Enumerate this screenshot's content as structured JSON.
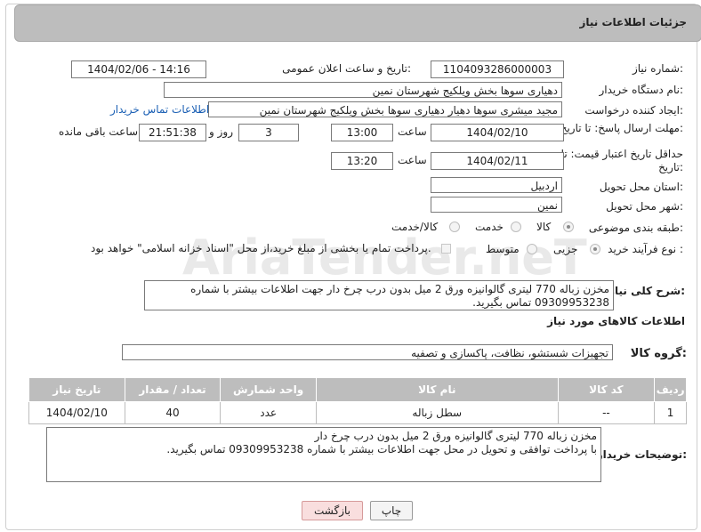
{
  "page": {
    "title": "جزئیات اطلاعات نیاز"
  },
  "fields": {
    "need_number_label": "شماره نیاز:",
    "need_number": "1104093286000003",
    "announce_label": "تاریخ و ساعت اعلان عمومی:",
    "announce_value": "1404/02/06 - 14:16",
    "buyer_org_label": "نام دستگاه خریدار:",
    "buyer_org": "دهیاری سوها بخش ویلکیج شهرستان نمین",
    "requester_label": "ایجاد کننده درخواست:",
    "requester": "مجید میشری سوها دهیار دهیاری سوها بخش ویلکیج شهرستان نمین",
    "buyer_contact_link": "اطلاعات تماس خریدار",
    "reply_deadline_label": "مهلت ارسال پاسخ: تا تاریخ:",
    "reply_date": "1404/02/10",
    "time_label": "ساعت",
    "reply_time": "13:00",
    "days": "3",
    "days_label": "روز و",
    "remaining": "21:51:38",
    "remaining_label": "ساعت باقی مانده",
    "price_validity_label": "حداقل تاریخ اعتبار قیمت: تا تاریخ:",
    "validity_date": "1404/02/11",
    "validity_time": "13:20",
    "province_label": "استان محل تحویل:",
    "province": "اردبیل",
    "city_label": "شهر محل تحویل:",
    "city": "نمین",
    "category_label": "طبقه بندی موضوعی:",
    "category_options": [
      "کالا",
      "خدمت",
      "کالا/خدمت"
    ],
    "purchase_type_label": "نوع فرآیند خرید :",
    "purchase_options": [
      "جزیی",
      "متوسط"
    ],
    "payment_note": "پرداخت تمام یا بخشی از مبلغ خرید،از محل \"اسناد خزانه اسلامی\" خواهد بود."
  },
  "description": {
    "label": "شرح کلی نیاز:",
    "text": "مخزن زباله 770 لیتری گالوانیزه ورق 2 میل بدون درب چرخ دار جهت اطلاعات بیشتر با شماره 09309953238 تماس بگیرید."
  },
  "goods": {
    "section_title": "اطلاعات کالاهای مورد نیاز",
    "group_label": "گروه کالا:",
    "group_value": "تجهیزات شستشو، نظافت، پاکسازی و تصفیه",
    "columns": [
      "ردیف",
      "کد کالا",
      "نام کالا",
      "واحد شمارش",
      "تعداد / مقدار",
      "تاریخ نیاز"
    ],
    "rows": [
      {
        "row": "1",
        "code": "--",
        "name": "سطل زباله",
        "unit": "عدد",
        "qty": "40",
        "date": "1404/02/10"
      }
    ]
  },
  "buyer_notes": {
    "label": "توضیحات خریدار:",
    "line1": "مخزن زباله 770 لیتری گالوانیزه ورق 2 میل بدون درب چرخ دار",
    "line2": "با پرداخت توافقی و تحویل در محل جهت اطلاعات بیشتر با شماره 09309953238 تماس بگیرید."
  },
  "buttons": {
    "print": "چاپ",
    "back": "بازگشت"
  },
  "watermark": "AriaTender.neT",
  "colors": {
    "header": "#bdbdbd",
    "link": "#1a5fb4",
    "back_button": "#f9dede"
  }
}
